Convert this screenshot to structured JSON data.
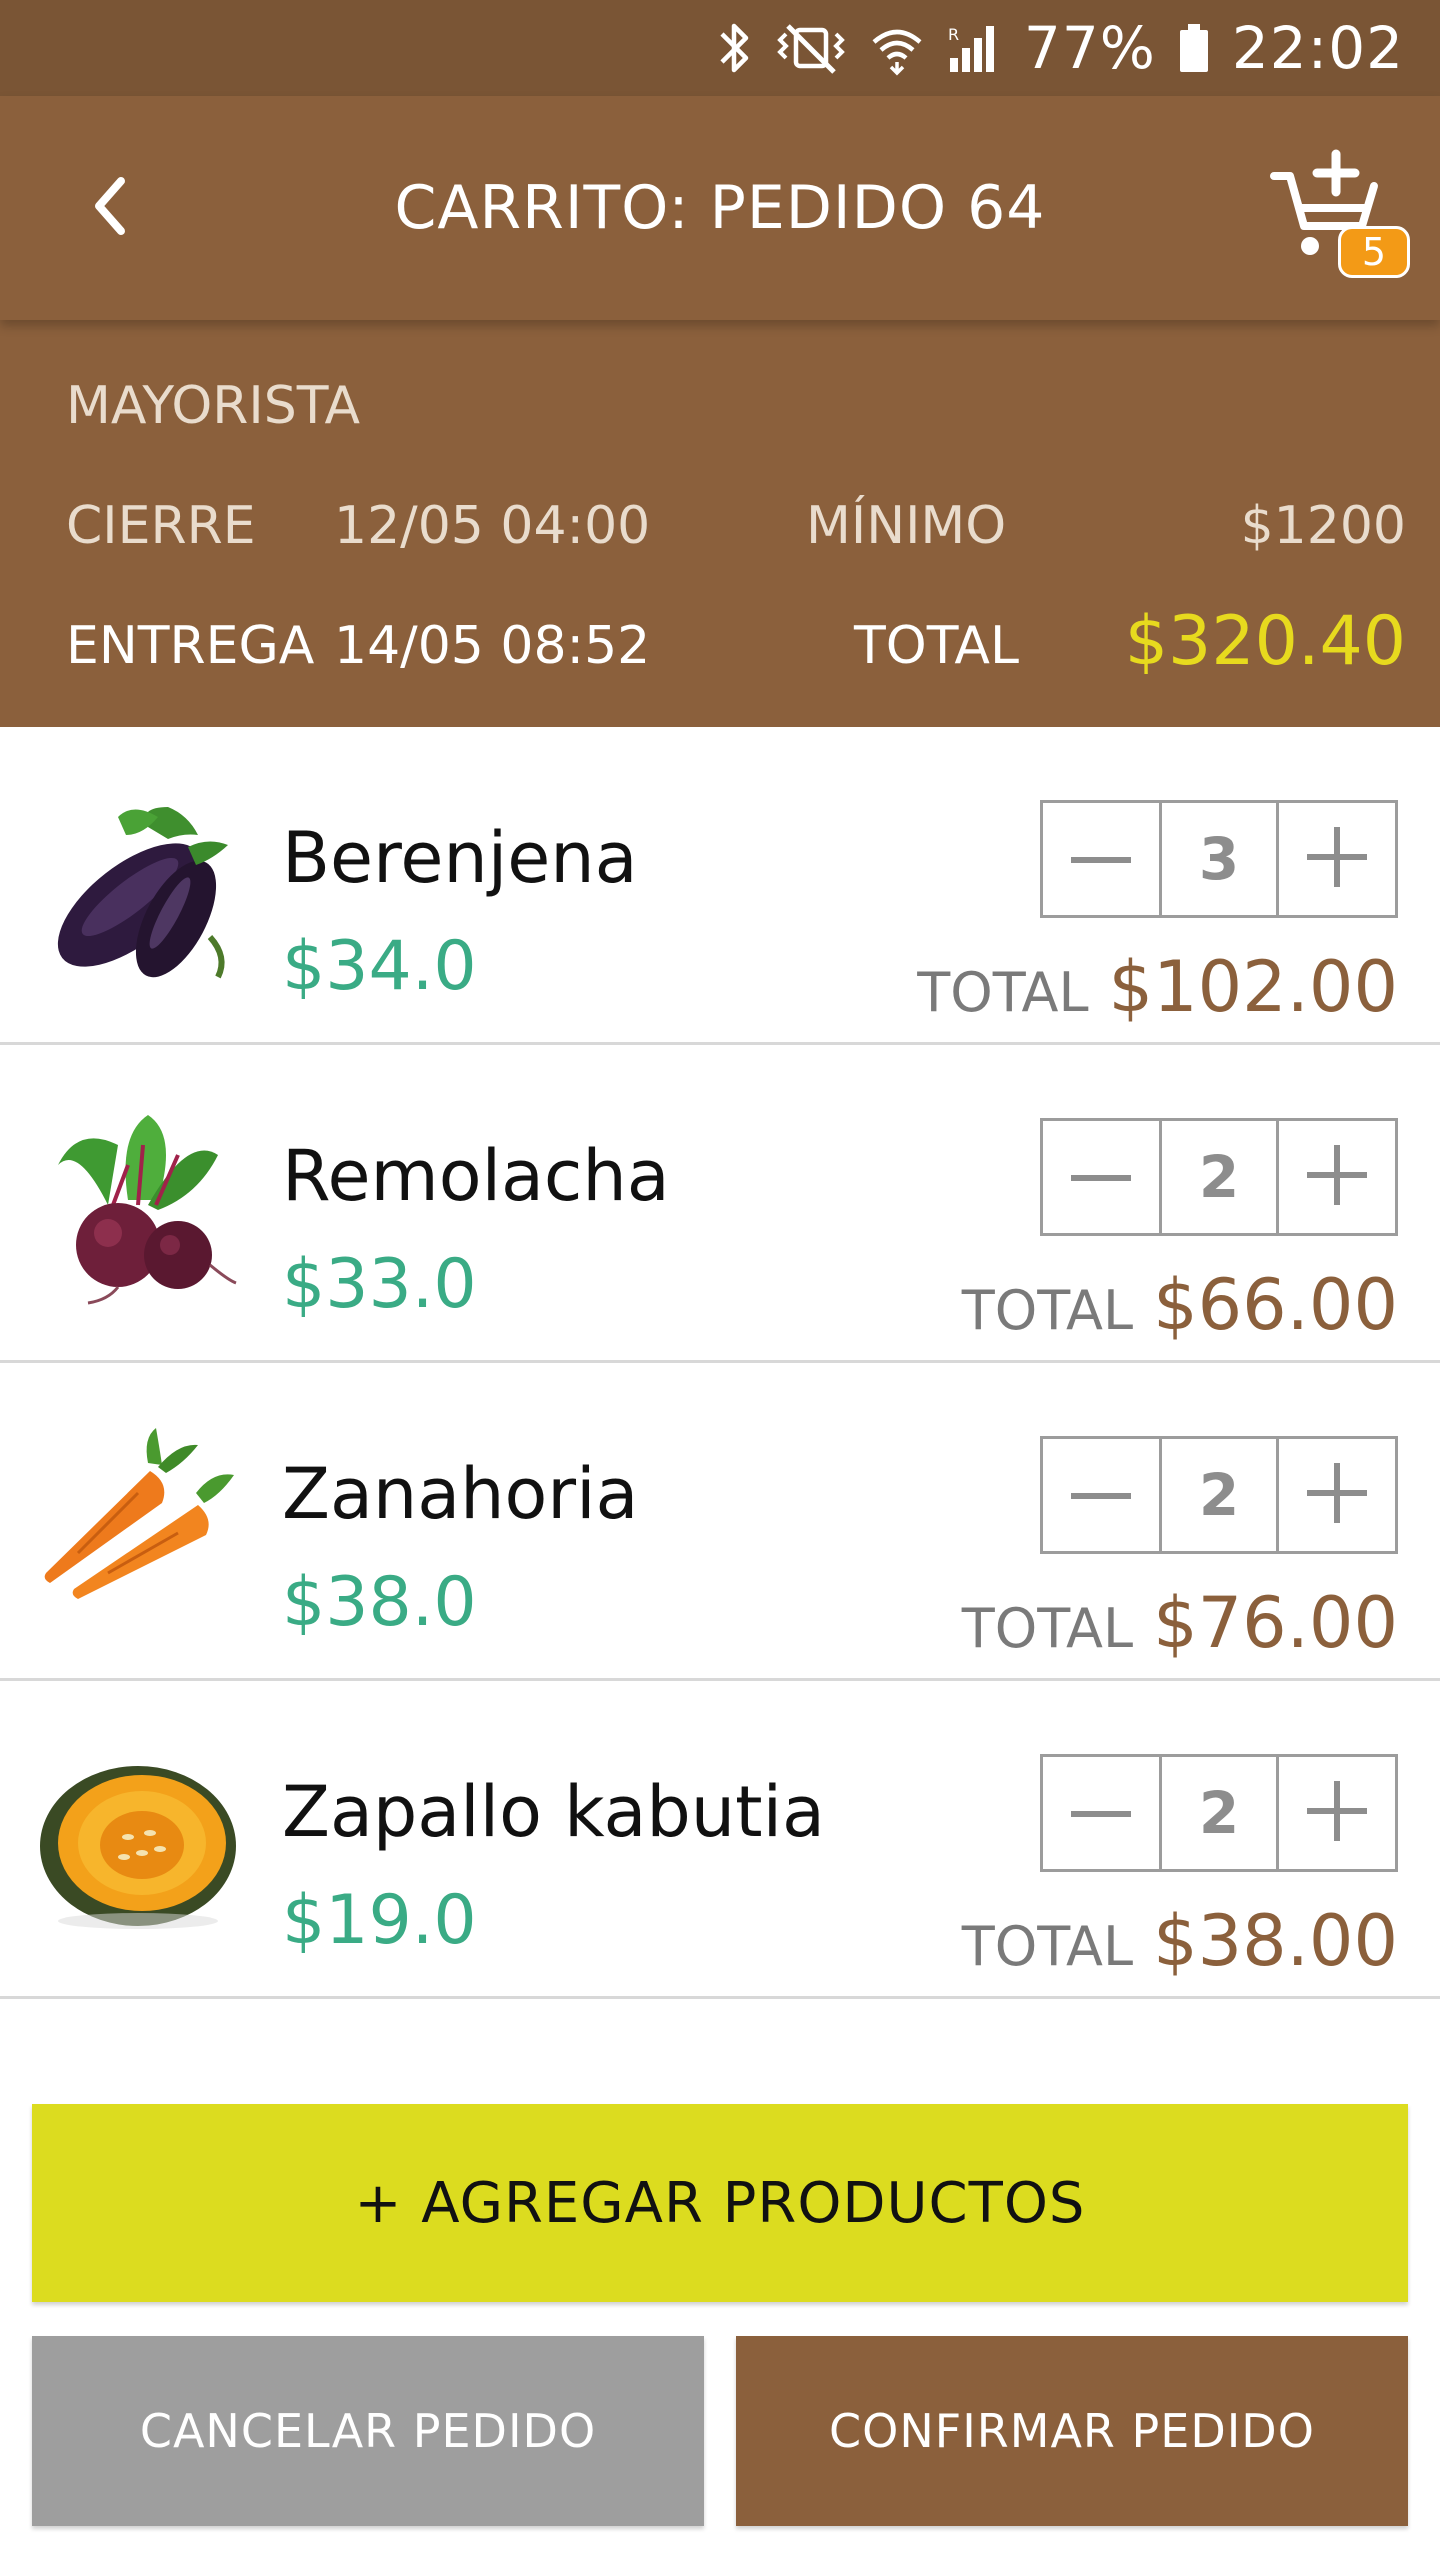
{
  "status_bar": {
    "icons": [
      "bluetooth-icon",
      "vibrate-icon",
      "wifi-icon",
      "signal-icon",
      "battery-icon"
    ],
    "battery": "77%",
    "time": "22:02"
  },
  "app_bar": {
    "title": "CARRITO: PEDIDO 64",
    "back_icon": "chevron-left-icon",
    "cart_icon": "cart-add-icon",
    "cart_count": "5"
  },
  "order_info": {
    "type": "MAYORISTA",
    "close_label": "CIERRE",
    "close_value": "12/05 04:00",
    "minimum_label": "MÍNIMO",
    "minimum_value": "$1200",
    "delivery_label": "ENTREGA",
    "delivery_value": "14/05 08:52",
    "total_label": "TOTAL",
    "total_value": "$320.40"
  },
  "products": [
    {
      "name": "Berenjena",
      "price": "$34.0",
      "quantity": "3",
      "total_label": "TOTAL",
      "total": "$102.00",
      "image": "eggplant"
    },
    {
      "name": "Remolacha",
      "price": "$33.0",
      "quantity": "2",
      "total_label": "TOTAL",
      "total": "$66.00",
      "image": "beet"
    },
    {
      "name": "Zanahoria",
      "price": "$38.0",
      "quantity": "2",
      "total_label": "TOTAL",
      "total": "$76.00",
      "image": "carrot"
    },
    {
      "name": "Zapallo kabutia",
      "price": "$19.0",
      "quantity": "2",
      "total_label": "TOTAL",
      "total": "$38.00",
      "image": "pumpkin"
    }
  ],
  "actions": {
    "add_products": "+ AGREGAR PRODUCTOS",
    "cancel": "CANCELAR PEDIDO",
    "confirm": "CONFIRMAR PEDIDO"
  },
  "colors": {
    "brand_brown": "#8b603c",
    "status_brown": "#7a5535",
    "accent_yellow": "#dcdc1f",
    "price_green": "#3aab85",
    "total_yellow": "#e7da1e",
    "badge_orange": "#f39a16",
    "cancel_gray": "#9e9e9e"
  }
}
